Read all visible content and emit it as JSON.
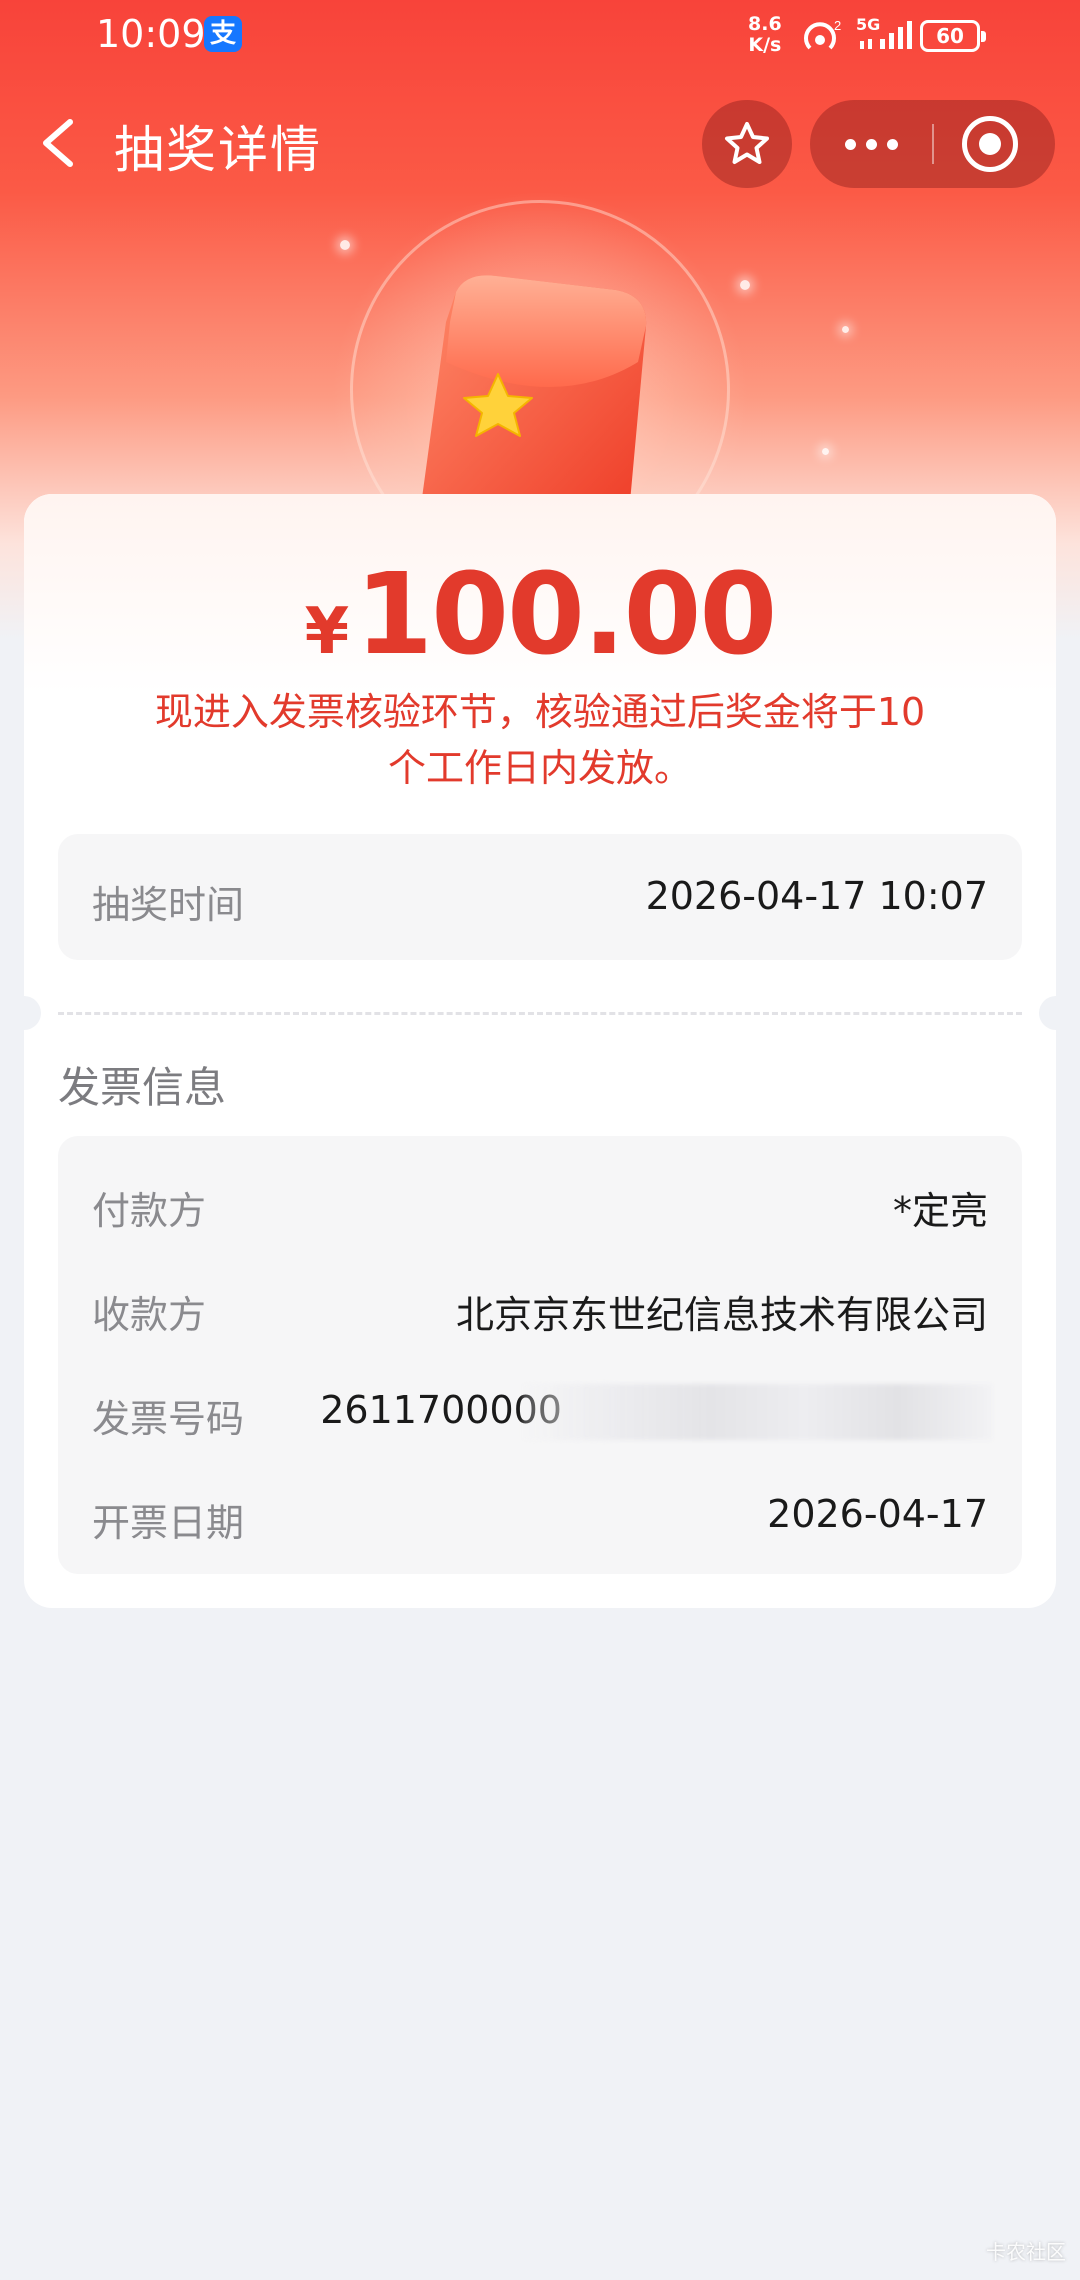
{
  "status_bar": {
    "time": "10:09",
    "alipay_badge": "支",
    "net_speed_value": "8.6",
    "net_speed_unit": "K/s",
    "signal_label": "5G",
    "battery": "60"
  },
  "nav": {
    "title": "抽奖详情"
  },
  "prize": {
    "currency": "¥",
    "amount": "100.00",
    "notice_line1": "现进入发票核验环节，核验通过后奖金将于10",
    "notice_line2": "个工作日内发放。",
    "accent_color": "#e23a2c"
  },
  "draw_time": {
    "label": "抽奖时间",
    "value": "2026-04-17 10:07"
  },
  "invoice": {
    "section_title": "发票信息",
    "rows": [
      {
        "label": "付款方",
        "value": "*定亮"
      },
      {
        "label": "收款方",
        "value": "北京京东世纪信息技术有限公司"
      },
      {
        "label": "发票号码",
        "value": "2611700000"
      },
      {
        "label": "开票日期",
        "value": "2026-04-17"
      }
    ]
  },
  "watermark": "卡农社区"
}
